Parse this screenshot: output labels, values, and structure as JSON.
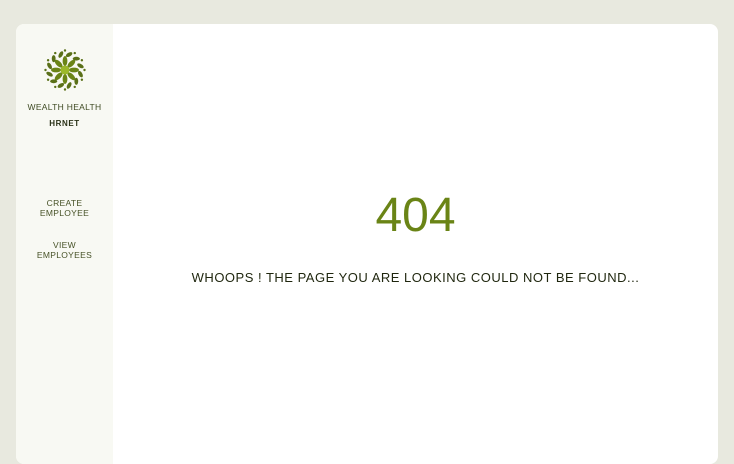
{
  "sidebar": {
    "logo_icon": "flower-mandala-icon",
    "brand_name": "WEALTH HEALTH",
    "app_name": "HRNET",
    "items": [
      {
        "label": "CREATE\nEMPLOYEE"
      },
      {
        "label": "VIEW\nEMPLOYEES"
      }
    ]
  },
  "main": {
    "error_code": "404",
    "error_message": "WHOOPS ! THE PAGE YOU ARE LOOKING COULD NOT BE FOUND..."
  },
  "colors": {
    "accent": "#6a8416",
    "page_bg": "#e8e9df",
    "sidebar_bg": "#f8f9f3"
  }
}
